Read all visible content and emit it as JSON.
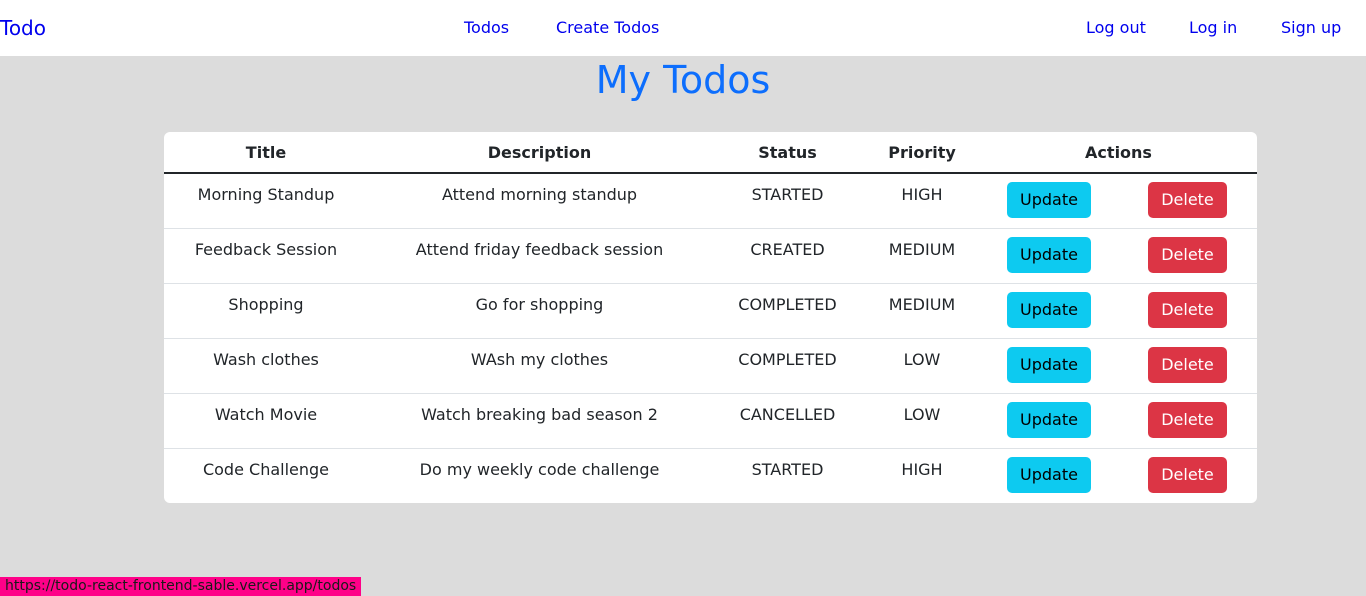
{
  "navbar": {
    "brand": "Todo",
    "center_links": [
      "Todos",
      "Create Todos"
    ],
    "right_links": [
      "Log out",
      "Log in",
      "Sign up"
    ]
  },
  "page": {
    "title": "My Todos"
  },
  "table": {
    "headers": [
      "Title",
      "Description",
      "Status",
      "Priority",
      "Actions"
    ],
    "update_label": "Update",
    "delete_label": "Delete",
    "rows": [
      {
        "title": "Morning Standup",
        "description": "Attend morning standup",
        "status": "STARTED",
        "priority": "HIGH"
      },
      {
        "title": "Feedback Session",
        "description": "Attend friday feedback session",
        "status": "CREATED",
        "priority": "MEDIUM"
      },
      {
        "title": "Shopping",
        "description": "Go for shopping",
        "status": "COMPLETED",
        "priority": "MEDIUM"
      },
      {
        "title": "Wash clothes",
        "description": "WAsh my clothes",
        "status": "COMPLETED",
        "priority": "LOW"
      },
      {
        "title": "Watch Movie",
        "description": "Watch breaking bad season 2",
        "status": "CANCELLED",
        "priority": "LOW"
      },
      {
        "title": "Code Challenge",
        "description": "Do my weekly code challenge",
        "status": "STARTED",
        "priority": "HIGH"
      }
    ]
  },
  "status_bar": {
    "url": "https://todo-react-frontend-sable.vercel.app/todos"
  },
  "colors": {
    "update_button": "#0dcaf0",
    "delete_button": "#dc3545",
    "title": "#0d6efd",
    "page_background": "#dcdcdc",
    "status_url_background": "#ff0088"
  }
}
